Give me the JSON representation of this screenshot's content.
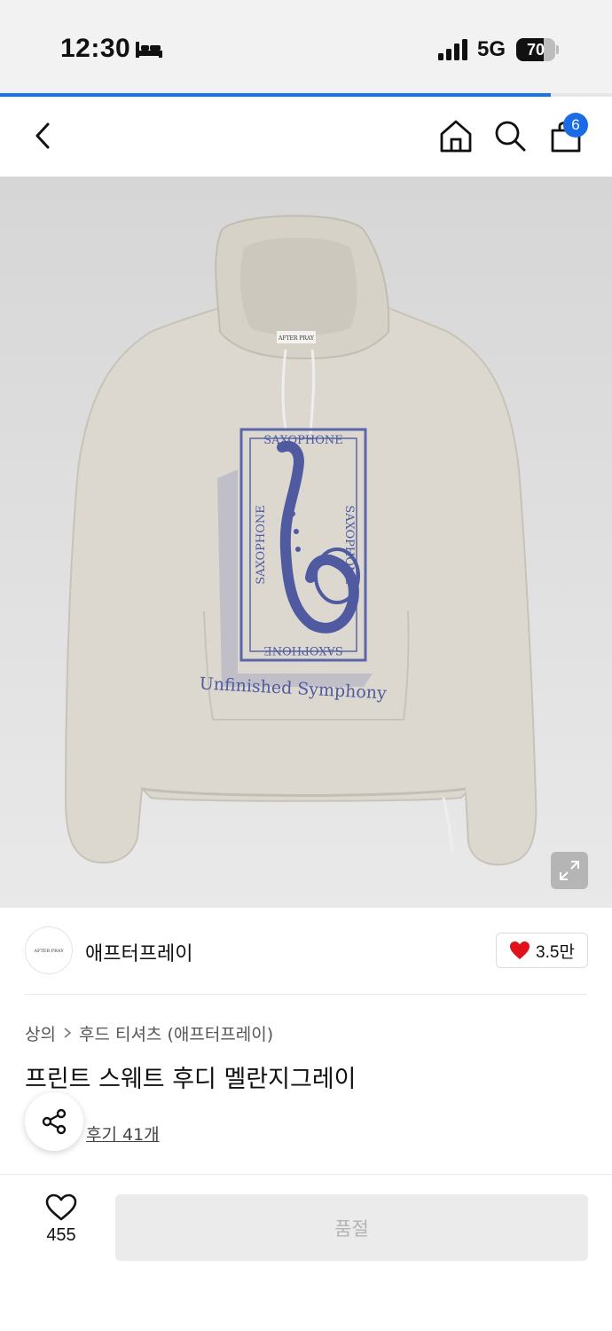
{
  "status_bar": {
    "time": "12:30",
    "network": "5G",
    "battery_level": "70",
    "battery_fraction": 0.7,
    "icons": [
      "bed-icon",
      "signal-icon",
      "battery-icon"
    ]
  },
  "page_load": {
    "progress_fraction": 0.9
  },
  "nav": {
    "icons": [
      "back-icon",
      "home-icon",
      "search-icon",
      "cart-icon"
    ],
    "cart_count": "6",
    "accent_color": "#1a6ce6"
  },
  "hero": {
    "print_text_1": "SAXOPHONE",
    "print_text_2": "Unfinished Symphony",
    "label_text": "AFTER PRAY",
    "expand_icon": "expand-icon"
  },
  "brand": {
    "logo_text": "AFTER PRAY",
    "name": "애프터프레이",
    "like_count": "3.5만",
    "like_color": "#e0121b"
  },
  "product": {
    "breadcrumb": [
      "상의",
      "후드 티셔츠 (애프터프레이)"
    ],
    "title": "프린트 스웨트 후디 멜란지그레이",
    "review_link": "후기 41개"
  },
  "bottom_bar": {
    "wish_count": "455",
    "buy_button": "품절"
  }
}
